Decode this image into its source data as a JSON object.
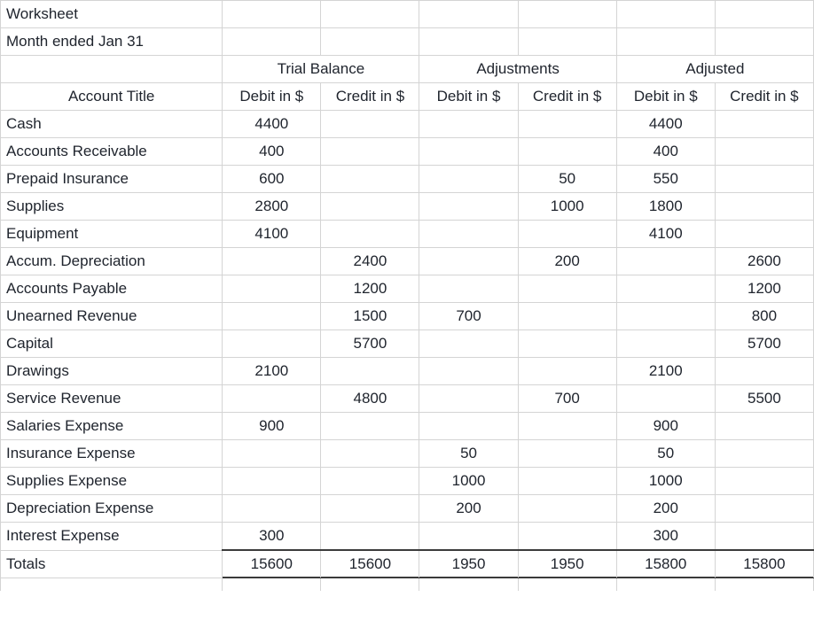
{
  "document": {
    "title_line_1": "Worksheet",
    "title_line_2": "Month ended Jan 31"
  },
  "table": {
    "row_label_header": "Account Title",
    "group_headers": [
      {
        "label": "Trial Balance",
        "span": 2
      },
      {
        "label": "Adjustments",
        "span": 2
      },
      {
        "label": "Adjusted",
        "span": 2
      }
    ],
    "column_headers": [
      "Debit in $",
      "Credit in $",
      "Debit in $",
      "Credit in $",
      "Debit in $",
      "Credit in $"
    ],
    "totals_label": "Totals",
    "totals": [
      "15600",
      "15600",
      "1950",
      "1950",
      "15800",
      "15800"
    ],
    "rows": [
      {
        "account": "Cash",
        "cells": [
          "4400",
          "",
          "",
          "",
          "4400",
          ""
        ]
      },
      {
        "account": "Accounts Receivable",
        "cells": [
          "400",
          "",
          "",
          "",
          "400",
          ""
        ]
      },
      {
        "account": "Prepaid Insurance",
        "cells": [
          "600",
          "",
          "",
          "50",
          "550",
          ""
        ]
      },
      {
        "account": "Supplies",
        "cells": [
          "2800",
          "",
          "",
          "1000",
          "1800",
          ""
        ]
      },
      {
        "account": "Equipment",
        "cells": [
          "4100",
          "",
          "",
          "",
          "4100",
          ""
        ]
      },
      {
        "account": "Accum. Depreciation",
        "cells": [
          "",
          "2400",
          "",
          "200",
          "",
          "2600"
        ]
      },
      {
        "account": "Accounts Payable",
        "cells": [
          "",
          "1200",
          "",
          "",
          "",
          "1200"
        ]
      },
      {
        "account": "Unearned Revenue",
        "cells": [
          "",
          "1500",
          "700",
          "",
          "",
          "800"
        ]
      },
      {
        "account": "Capital",
        "cells": [
          "",
          "5700",
          "",
          "",
          "",
          "5700"
        ]
      },
      {
        "account": "Drawings",
        "cells": [
          "2100",
          "",
          "",
          "",
          "2100",
          ""
        ]
      },
      {
        "account": "Service Revenue",
        "cells": [
          "",
          "4800",
          "",
          "700",
          "",
          "5500"
        ]
      },
      {
        "account": "Salaries Expense",
        "cells": [
          "900",
          "",
          "",
          "",
          "900",
          ""
        ]
      },
      {
        "account": "Insurance Expense",
        "cells": [
          "",
          "",
          "50",
          "",
          "50",
          ""
        ]
      },
      {
        "account": "Supplies Expense",
        "cells": [
          "",
          "",
          "1000",
          "",
          "1000",
          ""
        ]
      },
      {
        "account": "Depreciation Expense",
        "cells": [
          "",
          "",
          "200",
          "",
          "200",
          ""
        ]
      },
      {
        "account": "Interest Expense",
        "cells": [
          "300",
          "",
          "",
          "",
          "300",
          ""
        ]
      }
    ]
  },
  "style": {
    "text_color": "#20252e",
    "gridline_color": "#d4d4d4",
    "rule_color": "#3b3b3b",
    "background": "#ffffff"
  }
}
